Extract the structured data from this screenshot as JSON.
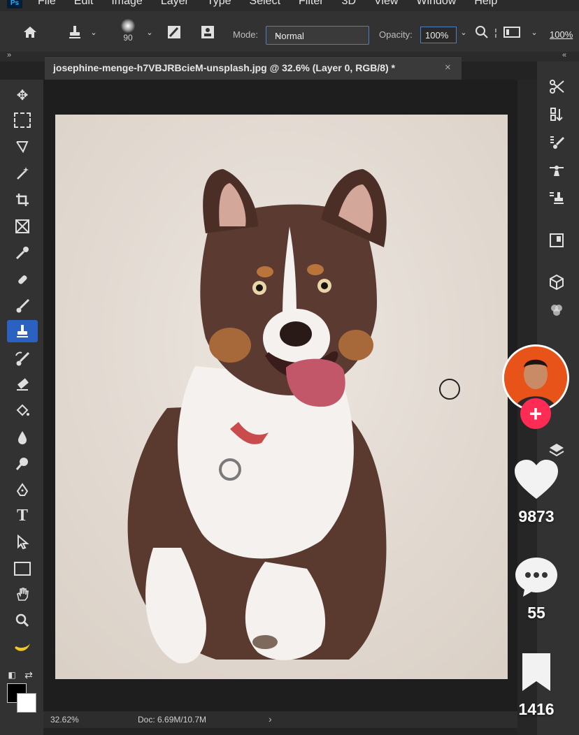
{
  "app": {
    "logo": "Ps"
  },
  "menu": [
    "File",
    "Edit",
    "Image",
    "Layer",
    "Type",
    "Select",
    "Filter",
    "3D",
    "View",
    "Window",
    "Help"
  ],
  "options": {
    "brush_size": "90",
    "mode_label": "Mode:",
    "mode_value": "Normal",
    "opacity_label": "Opacity:",
    "opacity_value": "100%",
    "flow_value": "100%"
  },
  "document": {
    "tab_title": "josephine-menge-h7VBJRBcieM-unsplash.jpg @ 32.6% (Layer 0, RGB/8) *",
    "close": "×"
  },
  "tools": [
    "move-tool",
    "marquee-tool",
    "lasso-tool",
    "magic-wand-tool",
    "crop-tool",
    "frame-tool",
    "eyedropper-tool",
    "healing-tool",
    "brush-tool",
    "clone-stamp-tool",
    "history-brush-tool",
    "eraser-tool",
    "paint-bucket-tool",
    "blur-tool",
    "dodge-tool",
    "pen-tool",
    "type-tool",
    "path-selection-tool",
    "rectangle-tool",
    "hand-tool",
    "zoom-tool",
    "banana-tool"
  ],
  "active_tool": "clone-stamp-tool",
  "status": {
    "zoom": "32.62%",
    "doc_size": "Doc: 6.69M/10.7M",
    "arrow": "›"
  },
  "social_overlay": {
    "follow_symbol": "+",
    "likes": "9873",
    "comments": "55",
    "bookmarks": "1416",
    "like_color": "#ffffff",
    "follow_color": "#fe2c55"
  },
  "colors": {
    "active_tool_bg": "#2b62c2",
    "foreground": "#000000",
    "background": "#ffffff"
  }
}
